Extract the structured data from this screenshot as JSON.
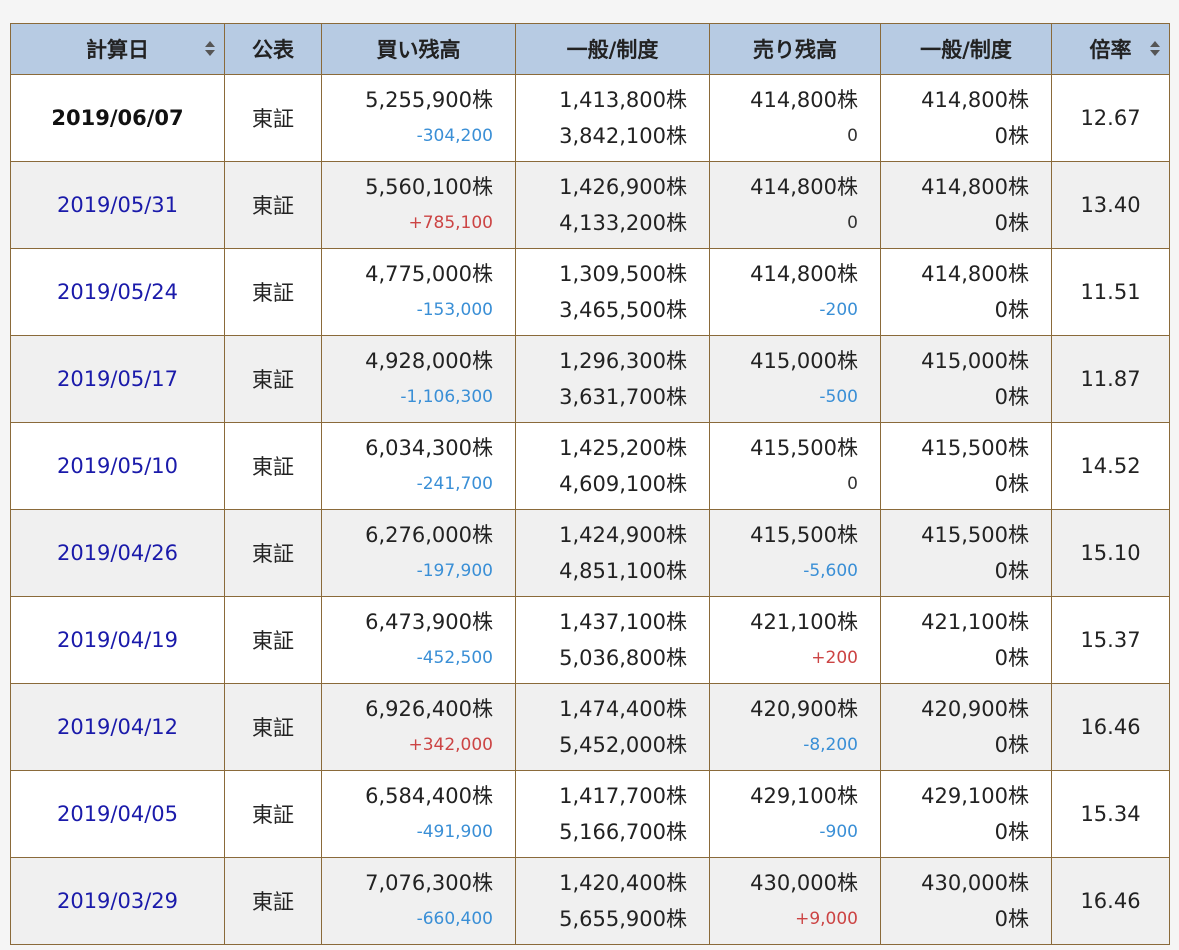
{
  "header": {
    "date": "計算日",
    "market": "公表",
    "buy": "買い残高",
    "buy_split": "一般/制度",
    "sell": "売り残高",
    "sell_split": "一般/制度",
    "ratio": "倍率"
  },
  "rows": [
    {
      "date": "2019/06/07",
      "market": "東証",
      "buy": "5,255,900株",
      "buy_chg": "-304,200",
      "buy_g": "1,413,800株",
      "buy_s": "3,842,100株",
      "sell": "414,800株",
      "sell_chg": "0",
      "sell_g": "414,800株",
      "sell_s": "0株",
      "ratio": "12.67"
    },
    {
      "date": "2019/05/31",
      "market": "東証",
      "buy": "5,560,100株",
      "buy_chg": "+785,100",
      "buy_g": "1,426,900株",
      "buy_s": "4,133,200株",
      "sell": "414,800株",
      "sell_chg": "0",
      "sell_g": "414,800株",
      "sell_s": "0株",
      "ratio": "13.40"
    },
    {
      "date": "2019/05/24",
      "market": "東証",
      "buy": "4,775,000株",
      "buy_chg": "-153,000",
      "buy_g": "1,309,500株",
      "buy_s": "3,465,500株",
      "sell": "414,800株",
      "sell_chg": "-200",
      "sell_g": "414,800株",
      "sell_s": "0株",
      "ratio": "11.51"
    },
    {
      "date": "2019/05/17",
      "market": "東証",
      "buy": "4,928,000株",
      "buy_chg": "-1,106,300",
      "buy_g": "1,296,300株",
      "buy_s": "3,631,700株",
      "sell": "415,000株",
      "sell_chg": "-500",
      "sell_g": "415,000株",
      "sell_s": "0株",
      "ratio": "11.87"
    },
    {
      "date": "2019/05/10",
      "market": "東証",
      "buy": "6,034,300株",
      "buy_chg": "-241,700",
      "buy_g": "1,425,200株",
      "buy_s": "4,609,100株",
      "sell": "415,500株",
      "sell_chg": "0",
      "sell_g": "415,500株",
      "sell_s": "0株",
      "ratio": "14.52"
    },
    {
      "date": "2019/04/26",
      "market": "東証",
      "buy": "6,276,000株",
      "buy_chg": "-197,900",
      "buy_g": "1,424,900株",
      "buy_s": "4,851,100株",
      "sell": "415,500株",
      "sell_chg": "-5,600",
      "sell_g": "415,500株",
      "sell_s": "0株",
      "ratio": "15.10"
    },
    {
      "date": "2019/04/19",
      "market": "東証",
      "buy": "6,473,900株",
      "buy_chg": "-452,500",
      "buy_g": "1,437,100株",
      "buy_s": "5,036,800株",
      "sell": "421,100株",
      "sell_chg": "+200",
      "sell_g": "421,100株",
      "sell_s": "0株",
      "ratio": "15.37"
    },
    {
      "date": "2019/04/12",
      "market": "東証",
      "buy": "6,926,400株",
      "buy_chg": "+342,000",
      "buy_g": "1,474,400株",
      "buy_s": "5,452,000株",
      "sell": "420,900株",
      "sell_chg": "-8,200",
      "sell_g": "420,900株",
      "sell_s": "0株",
      "ratio": "16.46"
    },
    {
      "date": "2019/04/05",
      "market": "東証",
      "buy": "6,584,400株",
      "buy_chg": "-491,900",
      "buy_g": "1,417,700株",
      "buy_s": "5,166,700株",
      "sell": "429,100株",
      "sell_chg": "-900",
      "sell_g": "429,100株",
      "sell_s": "0株",
      "ratio": "15.34"
    },
    {
      "date": "2019/03/29",
      "market": "東証",
      "buy": "7,076,300株",
      "buy_chg": "-660,400",
      "buy_g": "1,420,400株",
      "buy_s": "5,655,900株",
      "sell": "430,000株",
      "sell_chg": "+9,000",
      "sell_g": "430,000株",
      "sell_s": "0株",
      "ratio": "16.46"
    }
  ],
  "colors": {
    "header_bg": "#b7cbe3",
    "border": "#8a6a3a",
    "minus": "#3a8fd6",
    "plus": "#cc4444",
    "link": "#1a1aaa"
  },
  "icons": {
    "sort": "sort-updown-icon"
  }
}
